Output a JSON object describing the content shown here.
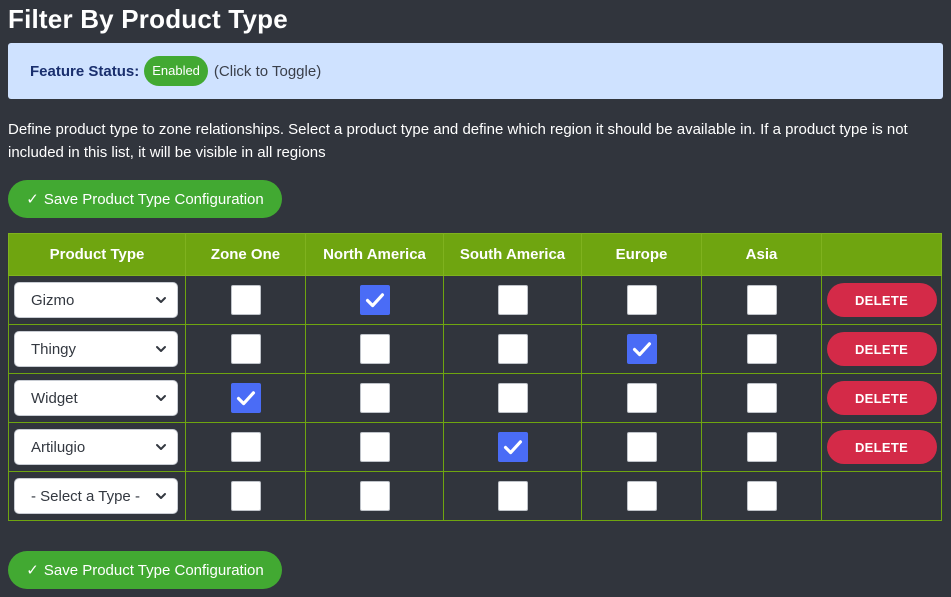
{
  "page": {
    "title": "Filter By Product Type"
  },
  "status": {
    "label": "Feature Status:",
    "value": "Enabled",
    "hint": "(Click to Toggle)"
  },
  "description": "Define product type to zone relationships. Select a product type and define which region it should be available in. If a product type is not included in this list, it will be visible in all regions",
  "save_label": "Save Product Type Configuration",
  "save_icon": "✓",
  "table": {
    "headers": [
      "Product Type",
      "Zone One",
      "North America",
      "South America",
      "Europe",
      "Asia",
      ""
    ],
    "delete_label": "DELETE",
    "rows": [
      {
        "type": "Gizmo",
        "checks": [
          false,
          true,
          false,
          false,
          false
        ],
        "deletable": true
      },
      {
        "type": "Thingy",
        "checks": [
          false,
          false,
          false,
          true,
          false
        ],
        "deletable": true
      },
      {
        "type": "Widget",
        "checks": [
          true,
          false,
          false,
          false,
          false
        ],
        "deletable": true
      },
      {
        "type": "Artilugio",
        "checks": [
          false,
          false,
          true,
          false,
          false
        ],
        "deletable": true
      },
      {
        "type": "- Select a Type -",
        "checks": [
          false,
          false,
          false,
          false,
          false
        ],
        "deletable": false
      }
    ]
  }
}
